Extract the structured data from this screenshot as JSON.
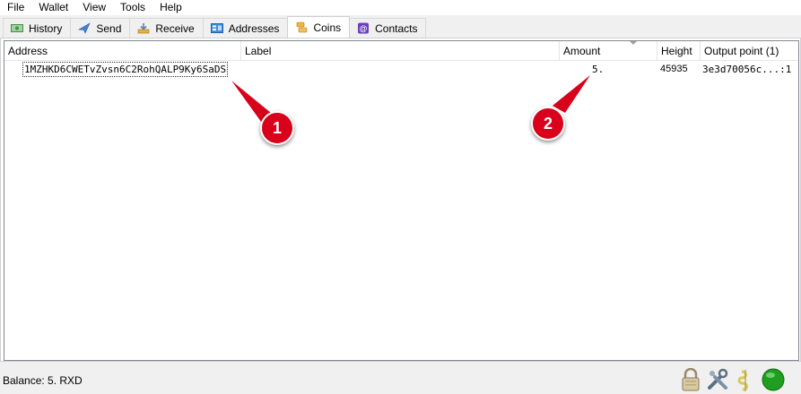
{
  "menu": [
    "File",
    "Wallet",
    "View",
    "Tools",
    "Help"
  ],
  "tabs": [
    {
      "label": "History",
      "icon": "history-icon"
    },
    {
      "label": "Send",
      "icon": "send-icon"
    },
    {
      "label": "Receive",
      "icon": "receive-icon"
    },
    {
      "label": "Addresses",
      "icon": "addresses-icon"
    },
    {
      "label": "Coins",
      "icon": "coins-icon",
      "active": true
    },
    {
      "label": "Contacts",
      "icon": "contacts-icon"
    }
  ],
  "table": {
    "columns": [
      "Address",
      "Label",
      "Amount",
      "Height",
      "Output point (1)"
    ],
    "sorted_column": "Amount",
    "rows": [
      {
        "address": "1MZHKD6CWETvZvsn6C2RohQALP9Ky6SaDS",
        "label": "",
        "amount": "5.",
        "height": "45935",
        "output_point": "3e3d70056c...:1"
      }
    ]
  },
  "callouts": [
    "1",
    "2"
  ],
  "status": {
    "balance": "Balance: 5. RXD",
    "icons": [
      "lock-icon",
      "preferences-icon",
      "seed-icon",
      "network-status-icon"
    ]
  },
  "colors": {
    "callout": "#d8001b",
    "network_ok": "#1f9e1f"
  }
}
